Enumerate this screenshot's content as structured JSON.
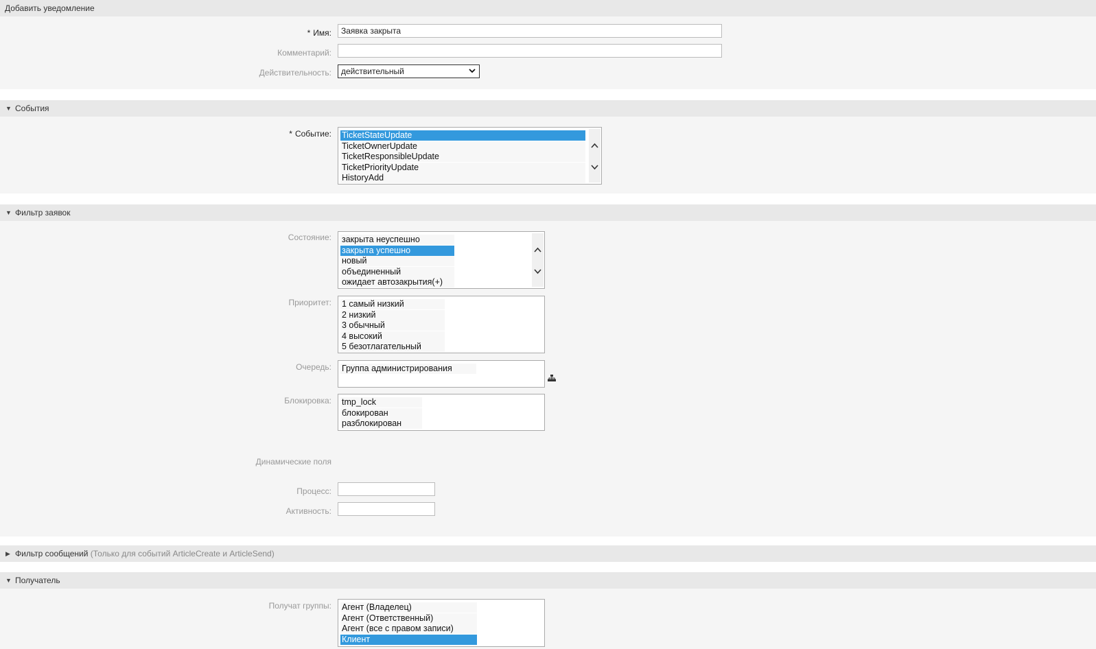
{
  "page_title": "Добавить уведомление",
  "general": {
    "name_label": "Имя:",
    "name_value": "Заявка закрыта",
    "comment_label": "Комментарий:",
    "comment_value": "",
    "validity_label": "Действительность:",
    "validity_value": "действительный",
    "required_mark": "*"
  },
  "events": {
    "title": "События",
    "event_label": "Событие:",
    "options": [
      "TicketStateUpdate",
      "TicketOwnerUpdate",
      "TicketResponsibleUpdate",
      "TicketPriorityUpdate",
      "HistoryAdd"
    ],
    "selected": [
      "TicketStateUpdate"
    ]
  },
  "ticket_filter": {
    "title": "Фильтр заявок",
    "state_label": "Состояние:",
    "state_options": [
      "закрыта неуспешно",
      "закрыта успешно",
      "новый",
      "объединенный",
      "ожидает автозакрытия(+)"
    ],
    "state_selected": [
      "закрыта успешно"
    ],
    "priority_label": "Приоритет:",
    "priority_options": [
      "1 самый низкий",
      "2 низкий",
      "3 обычный",
      "4 высокий",
      "5 безотлагательный"
    ],
    "queue_label": "Очередь:",
    "queue_options": [
      "Группа администрирования"
    ],
    "lock_label": "Блокировка:",
    "lock_options": [
      "tmp_lock",
      "блокирован",
      "разблокирован"
    ],
    "dynamic_fields_label": "Динамические поля",
    "process_label": "Процесс:",
    "process_value": "",
    "activity_label": "Активность:",
    "activity_value": ""
  },
  "article_filter": {
    "title": "Фильтр сообщений",
    "subtitle": "(Только для событий ArticleCreate и ArticleSend)"
  },
  "recipient": {
    "title": "Получатель",
    "groups_label": "Получат группы:",
    "groups_options": [
      "Агент (Владелец)",
      "Агент (Ответственный)",
      "Агент (все с правом записи)",
      "Клиент"
    ],
    "groups_selected": [
      "Клиент"
    ]
  },
  "icons": {
    "expanded": "triangle-down-icon",
    "collapsed": "triangle-right-icon",
    "dropdown": "chevron-down-icon",
    "scroll_up": "chevron-up-icon",
    "scroll_down": "chevron-down-icon",
    "queue_tree": "tree-icon"
  },
  "colors": {
    "selection": "#3399dd",
    "header_bg": "#e8e8e8",
    "panel_bg": "#f5f5f5"
  }
}
